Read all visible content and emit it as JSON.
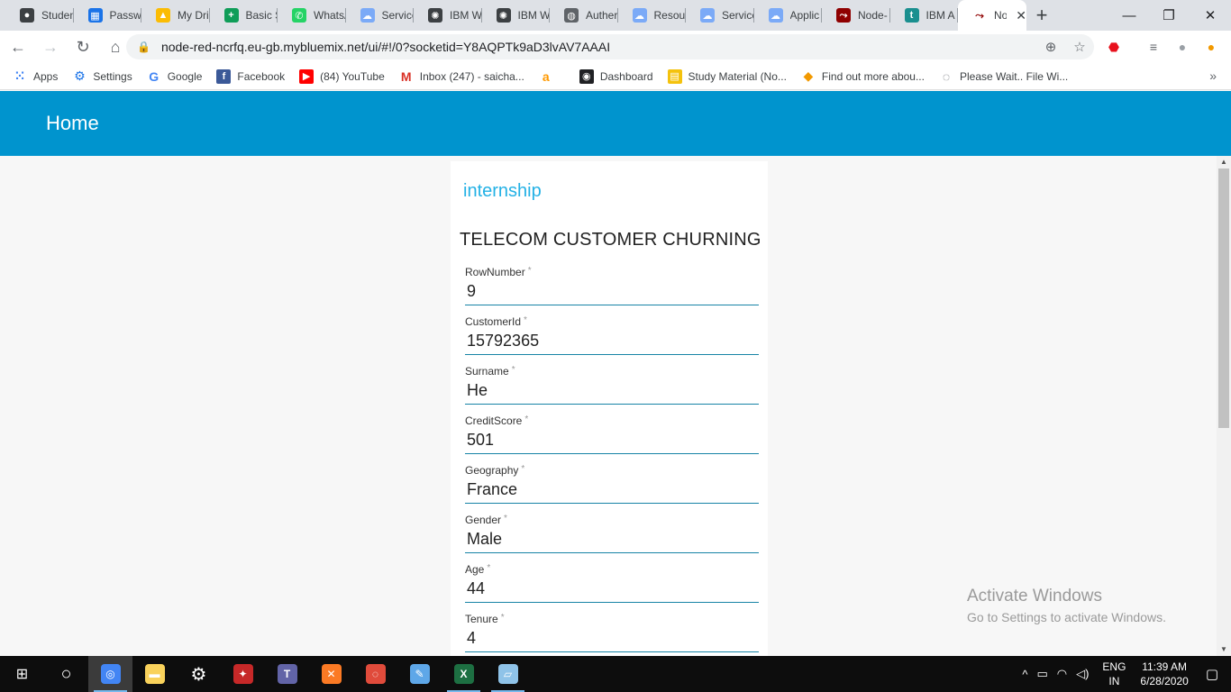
{
  "browser": {
    "tabs": [
      {
        "label": "Studen",
        "icon": "github-icon",
        "color": "#3c4043"
      },
      {
        "label": "Passwo",
        "icon": "chart-icon",
        "color": "#1a73e8"
      },
      {
        "label": "My Dri",
        "icon": "drive-icon",
        "color": "#fbbc04"
      },
      {
        "label": "Basic S",
        "icon": "sheets-icon",
        "color": "#0f9d58"
      },
      {
        "label": "WhatsA",
        "icon": "whatsapp-icon",
        "color": "#25d366"
      },
      {
        "label": "Service",
        "icon": "cloud-icon",
        "color": "#7baaf7"
      },
      {
        "label": "IBM W",
        "icon": "watson-icon",
        "color": "#3c4043"
      },
      {
        "label": "IBM W",
        "icon": "watson-icon",
        "color": "#3c4043"
      },
      {
        "label": "Auther",
        "icon": "globe-icon",
        "color": "#5f6368"
      },
      {
        "label": "Resour",
        "icon": "cloud-icon",
        "color": "#7baaf7"
      },
      {
        "label": "Service",
        "icon": "cloud-icon",
        "color": "#7baaf7"
      },
      {
        "label": "Applic",
        "icon": "cloud-icon",
        "color": "#7baaf7"
      },
      {
        "label": "Node-",
        "icon": "node-red-icon",
        "color": "#8f0000"
      },
      {
        "label": "IBM A",
        "icon": "t-icon",
        "color": "#1a8f8f"
      }
    ],
    "active_tab": {
      "label": "No",
      "icon": "node-red-icon"
    },
    "url": "node-red-ncrfq.eu-gb.mybluemix.net/ui/#!/0?socketid=Y8AQPTk9aD3lvAV7AAAI",
    "bookmarks": [
      {
        "label": "Apps",
        "icon": "apps-grid-icon",
        "color": "#4285f4"
      },
      {
        "label": "Settings",
        "icon": "gear-icon",
        "color": "#1a73e8"
      },
      {
        "label": "Google",
        "icon": "google-icon",
        "color": "#4285f4"
      },
      {
        "label": "Facebook",
        "icon": "facebook-icon",
        "color": "#3b5998"
      },
      {
        "label": "(84) YouTube",
        "icon": "youtube-icon",
        "color": "#ff0000"
      },
      {
        "label": "Inbox (247) - saicha...",
        "icon": "gmail-icon",
        "color": "#d93025"
      },
      {
        "label": "",
        "icon": "amazon-icon",
        "color": "#ff9900"
      },
      {
        "label": "Dashboard",
        "icon": "dashboard-icon",
        "color": "#202124"
      },
      {
        "label": "Study Material (No...",
        "icon": "study-icon",
        "color": "#f4c20d"
      },
      {
        "label": "Find out more abou...",
        "icon": "diamond-icon",
        "color": "#f29900"
      },
      {
        "label": "Please Wait.. File Wi...",
        "icon": "loading-icon",
        "color": "#5f6368"
      }
    ]
  },
  "page": {
    "header_title": "Home",
    "group_title": "internship",
    "form_title": "TELECOM CUSTOMER CHURNING",
    "required_mark": "*",
    "fields": [
      {
        "label": "RowNumber",
        "value": "9"
      },
      {
        "label": "CustomerId",
        "value": "15792365"
      },
      {
        "label": "Surname",
        "value": "He"
      },
      {
        "label": "CreditScore",
        "value": "501"
      },
      {
        "label": "Geography",
        "value": "France"
      },
      {
        "label": "Gender",
        "value": "Male"
      },
      {
        "label": "Age",
        "value": "44"
      },
      {
        "label": "Tenure",
        "value": "4"
      }
    ]
  },
  "watermark": {
    "line1": "Activate Windows",
    "line2": "Go to Settings to activate Windows."
  },
  "taskbar": {
    "apps": [
      {
        "name": "chrome-icon",
        "color": "#4285f4",
        "running": true,
        "active": true
      },
      {
        "name": "file-explorer-icon",
        "color": "#f9d25b",
        "running": false,
        "active": false
      },
      {
        "name": "settings-icon",
        "color": "#ffffff",
        "running": false,
        "active": false
      },
      {
        "name": "game-icon",
        "color": "#c62828",
        "running": false,
        "active": false
      },
      {
        "name": "teams-icon",
        "color": "#6264a7",
        "running": false,
        "active": false
      },
      {
        "name": "xampp-icon",
        "color": "#fb7a24",
        "running": false,
        "active": false
      },
      {
        "name": "anaconda-icon",
        "color": "#e04b3b",
        "running": false,
        "active": false
      },
      {
        "name": "paint-icon",
        "color": "#5ea7e8",
        "running": false,
        "active": false
      },
      {
        "name": "excel-icon",
        "color": "#1d6f42",
        "running": true,
        "active": false
      },
      {
        "name": "notepad-icon",
        "color": "#8fc3e8",
        "running": true,
        "active": false
      }
    ],
    "language": "ENG",
    "region": "IN",
    "time": "11:39 AM",
    "date": "6/28/2020"
  }
}
